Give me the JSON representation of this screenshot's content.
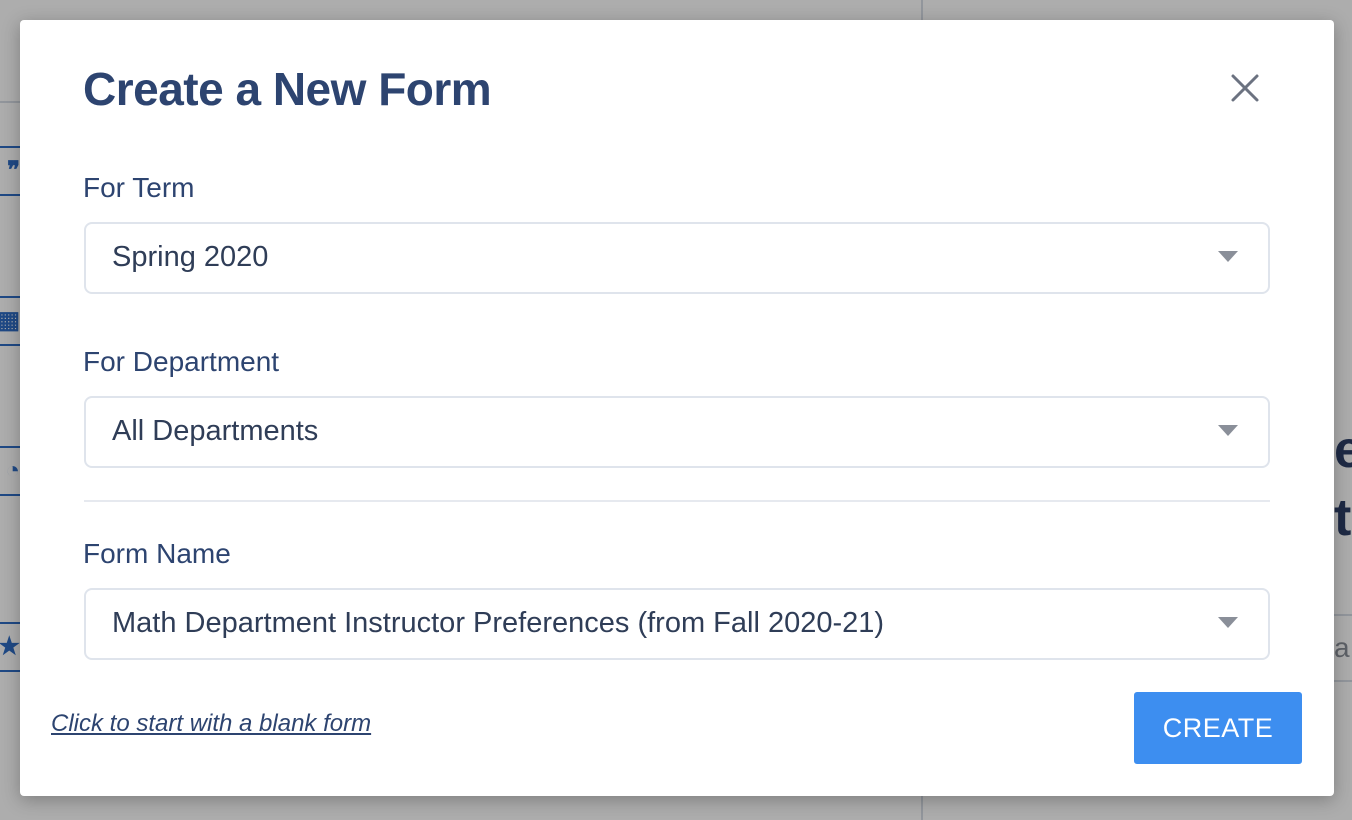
{
  "background": {
    "left_icons": [
      "quote-icon",
      "table-icon",
      "clock-icon",
      "star-icon"
    ],
    "right_text": [
      "e",
      "t",
      "a"
    ]
  },
  "modal": {
    "title": "Create a New Form",
    "close_icon": "close-icon",
    "term": {
      "label": "For Term",
      "selected": "Spring 2020"
    },
    "department": {
      "label": "For Department",
      "selected": "All Departments"
    },
    "form_name": {
      "label": "Form Name",
      "selected": "Math Department Instructor Preferences (from Fall 2020-21)"
    },
    "blank_form_link": "Click to start with a blank form",
    "create_button": "CREATE"
  },
  "colors": {
    "title": "#2d4470",
    "primary_button": "#3d8ef0",
    "overlay": "rgba(0,0,0,0.32)"
  }
}
